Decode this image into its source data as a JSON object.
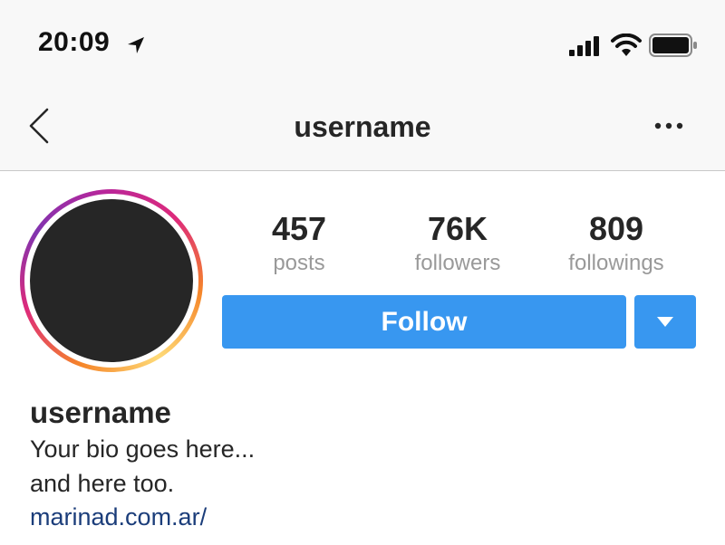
{
  "status_bar": {
    "time": "20:09",
    "icons": [
      "location-arrow-icon",
      "cellular-signal-icon",
      "wifi-icon",
      "battery-icon"
    ]
  },
  "nav": {
    "title": "username",
    "back_icon": "chevron-left-icon",
    "more_icon": "more-horizontal-icon"
  },
  "profile": {
    "stats": [
      {
        "value": "457",
        "label": "posts"
      },
      {
        "value": "76K",
        "label": "followers"
      },
      {
        "value": "809",
        "label": "followings"
      }
    ],
    "follow_label": "Follow",
    "dropdown_icon": "caret-down-icon",
    "name": "username",
    "bio_lines": [
      "Your bio goes here...",
      "and here too."
    ],
    "link": "marinad.com.ar/"
  },
  "colors": {
    "accent": "#3897f0",
    "link": "#1b3d7a",
    "muted_text": "#999999",
    "text": "#262626",
    "avatar": "#262626"
  }
}
